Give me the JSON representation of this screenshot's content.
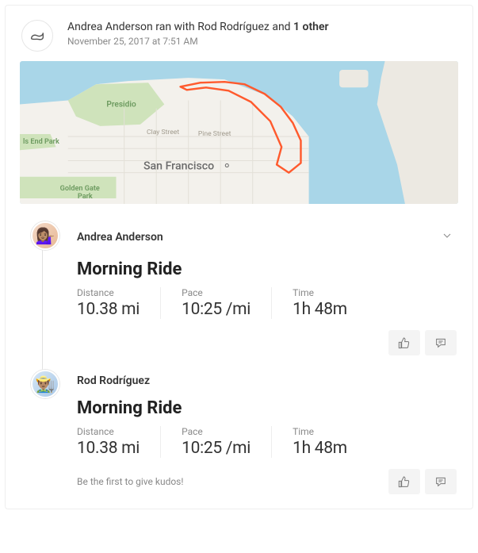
{
  "header": {
    "headline_prefix": "Andrea Anderson ran with Rod Rodríguez and ",
    "headline_bold": "1 other",
    "timestamp": "November 25, 2017 at 7:51 AM"
  },
  "map": {
    "labels": {
      "ends_park": "ls End Park",
      "presidio": "Presidio",
      "clay_st": "Clay Street",
      "pine_st": "Pine Street",
      "sf": "San Francisco",
      "gg_park": "Golden Gate Park"
    }
  },
  "entries": [
    {
      "avatar_emoji": "💁🏽‍♀️",
      "athlete": "Andrea Anderson",
      "activity_title": "Morning Ride",
      "show_chevron": true,
      "kudos_prompt": "",
      "stats": {
        "distance_label": "Distance",
        "distance_value": "10.38 mi",
        "pace_label": "Pace",
        "pace_value": "10:25 /mi",
        "time_label": "Time",
        "time_value": "1h 48m"
      }
    },
    {
      "avatar_emoji": "👨🏽‍🌾",
      "athlete": "Rod Rodríguez",
      "activity_title": "Morning Ride",
      "show_chevron": false,
      "kudos_prompt": "Be the first to give kudos!",
      "stats": {
        "distance_label": "Distance",
        "distance_value": "10.38 mi",
        "pace_label": "Pace",
        "pace_value": "10:25 /mi",
        "time_label": "Time",
        "time_value": "1h 48m"
      }
    }
  ]
}
